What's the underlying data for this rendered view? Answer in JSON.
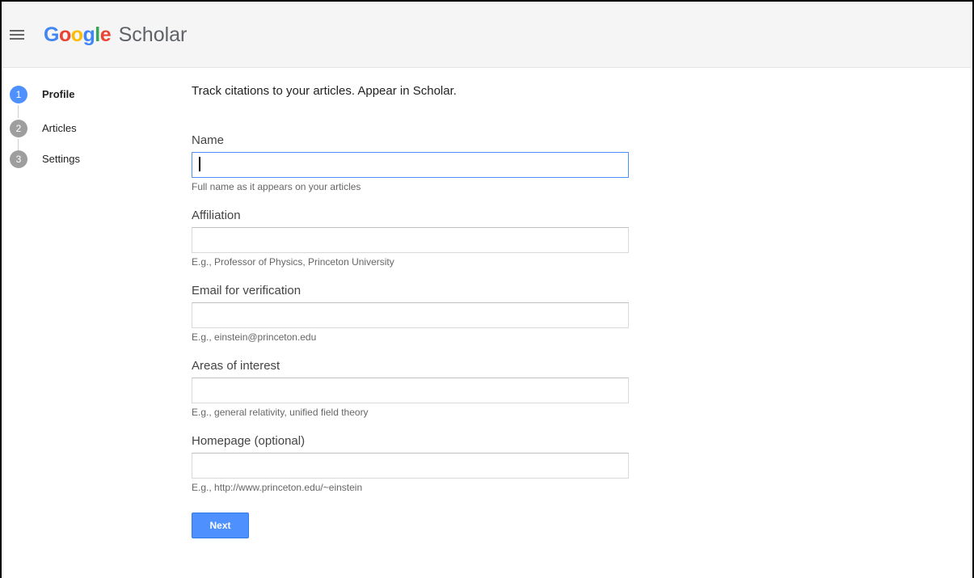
{
  "header": {
    "menu_icon": "hamburger-menu-icon",
    "logo": {
      "letters": [
        {
          "char": "G",
          "color": "#4285F4"
        },
        {
          "char": "o",
          "color": "#EA4335"
        },
        {
          "char": "o",
          "color": "#FBBC05"
        },
        {
          "char": "g",
          "color": "#4285F4"
        },
        {
          "char": "l",
          "color": "#34A853"
        },
        {
          "char": "e",
          "color": "#EA4335"
        }
      ],
      "product": "Scholar"
    }
  },
  "stepper": {
    "steps": [
      {
        "number": "1",
        "label": "Profile",
        "active": true
      },
      {
        "number": "2",
        "label": "Articles",
        "active": false
      },
      {
        "number": "3",
        "label": "Settings",
        "active": false
      }
    ],
    "active_color": "#4d90fe",
    "inactive_color": "#9e9e9e"
  },
  "form": {
    "tagline": "Track citations to your articles. Appear in Scholar.",
    "fields": [
      {
        "label": "Name",
        "value": "",
        "hint": "Full name as it appears on your articles",
        "focused": true
      },
      {
        "label": "Affiliation",
        "value": "",
        "hint": "E.g., Professor of Physics, Princeton University",
        "focused": false
      },
      {
        "label": "Email for verification",
        "value": "",
        "hint": "E.g., einstein@princeton.edu",
        "focused": false
      },
      {
        "label": "Areas of interest",
        "value": "",
        "hint": "E.g., general relativity, unified field theory",
        "focused": false
      },
      {
        "label": "Homepage (optional)",
        "value": "",
        "hint": "E.g., http://www.princeton.edu/~einstein",
        "focused": false
      }
    ],
    "next_label": "Next",
    "accent_color": "#4d90fe"
  }
}
